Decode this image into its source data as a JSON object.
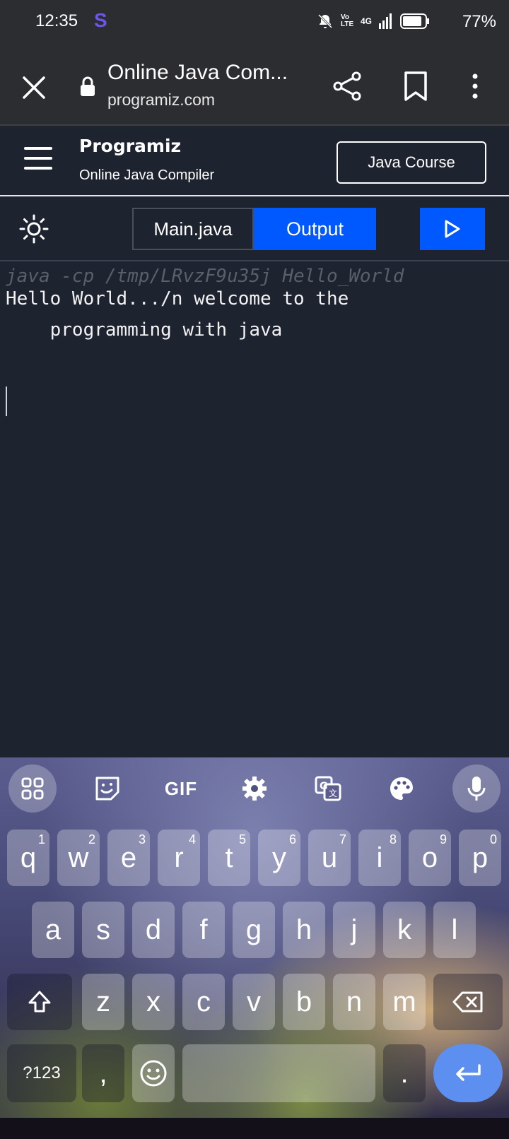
{
  "status": {
    "time": "12:35",
    "app_letter": "S",
    "network": "4G",
    "volte": "Vo LTE",
    "battery": "77%"
  },
  "browser": {
    "title": "Online Java Com...",
    "domain": "programiz.com"
  },
  "site": {
    "brand": "Programiz",
    "subtitle": "Online Java Compiler",
    "course_button": "Java Course"
  },
  "toolbar": {
    "file_tab": "Main.java",
    "output_tab": "Output"
  },
  "output": {
    "command": "java -cp /tmp/LRvzF9u35j Hello_World",
    "lines": [
      "Hello World.../n welcome to the",
      "    programming with java"
    ]
  },
  "keyboard": {
    "gif": "GIF",
    "row1": [
      {
        "key": "q",
        "hint": "1"
      },
      {
        "key": "w",
        "hint": "2"
      },
      {
        "key": "e",
        "hint": "3"
      },
      {
        "key": "r",
        "hint": "4"
      },
      {
        "key": "t",
        "hint": "5"
      },
      {
        "key": "y",
        "hint": "6"
      },
      {
        "key": "u",
        "hint": "7"
      },
      {
        "key": "i",
        "hint": "8"
      },
      {
        "key": "o",
        "hint": "9"
      },
      {
        "key": "p",
        "hint": "0"
      }
    ],
    "row2": [
      "a",
      "s",
      "d",
      "f",
      "g",
      "h",
      "j",
      "k",
      "l"
    ],
    "row3": [
      "z",
      "x",
      "c",
      "v",
      "b",
      "n",
      "m"
    ],
    "symbols_key": "?123",
    "comma_key": ",",
    "period_key": "."
  }
}
